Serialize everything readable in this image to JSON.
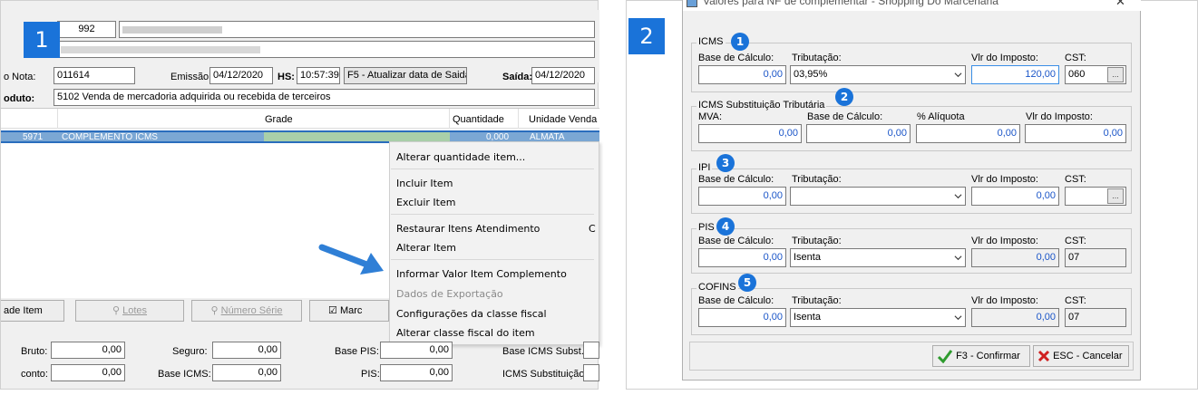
{
  "panel1": {
    "badge": "1",
    "header": {
      "code": "992"
    },
    "nota_label": "o Nota:",
    "nota_value": "011614",
    "emissao_label": "Emissão:",
    "emissao_value": "04/12/2020",
    "hs_label": "HS:",
    "hs_value": "10:57:39",
    "f5_label": "F5 - Atualizar data de Saida",
    "saida_label": "Saída:",
    "saida_value": "04/12/2020",
    "produto_label": "oduto:",
    "produto_value": "5102 Venda de mercadoria adquirida ou recebida de terceiros",
    "columns": {
      "grade": "Grade",
      "quantidade": "Quantidade",
      "unidade": "Unidade Venda"
    },
    "row": {
      "code": "5971",
      "desc": "COMPLEMENTO ICMS",
      "qty": "0,000",
      "unit": "ALMATA"
    },
    "context_menu": {
      "alterar_qtd": "Alterar quantidade item...",
      "incluir": "Incluir Item",
      "excluir": "Excluir Item",
      "restaurar": "Restaurar Itens Atendimento",
      "restaurar_shortcut": "C",
      "alterar_item": "Alterar Item",
      "informar": "Informar Valor Item Complemento",
      "dados_exportacao": "Dados de Exportação",
      "configuracoes": "Configurações da classe fiscal",
      "alterar_classe": "Alterar classe fiscal do item"
    },
    "buttons": {
      "item": "ade Item",
      "lotes": "Lotes",
      "numero_serie": "Número Série",
      "marcar": "Marc"
    },
    "totals": {
      "bruto_label": "Bruto:",
      "bruto": "0,00",
      "seguro_label": "Seguro:",
      "seguro": "0,00",
      "base_pis_label": "Base PIS:",
      "base_pis": "0,00",
      "base_icms_subst_label": "Base ICMS Subst.:",
      "desconto_label": "conto:",
      "desconto": "0,00",
      "base_icms_label": "Base ICMS:",
      "base_icms": "0,00",
      "pis_label": "PIS:",
      "pis": "0,00",
      "icms_subst_label": "ICMS Substituição:"
    }
  },
  "panel2": {
    "badge": "2",
    "title": "Valores para NF de complementar - Shopping Do Marcenaria",
    "icms": {
      "title": "ICMS",
      "badge": "1",
      "base_label": "Base de Cálculo:",
      "base": "0,00",
      "trib_label": "Tributação:",
      "trib": "03,95%",
      "vlr_label": "Vlr do Imposto:",
      "vlr": "120,00",
      "cst_label": "CST:",
      "cst": "060"
    },
    "icms_st": {
      "title": "ICMS Substituição Tributária",
      "badge": "2",
      "mva_label": "MVA:",
      "mva": "0,00",
      "base_label": "Base de Cálculo:",
      "base": "0,00",
      "aliq_label": "% Alíquota",
      "aliq": "0,00",
      "vlr_label": "Vlr do Imposto:",
      "vlr": "0,00"
    },
    "ipi": {
      "title": "IPI",
      "badge": "3",
      "base_label": "Base de Cálculo:",
      "base": "0,00",
      "trib_label": "Tributação:",
      "trib": "",
      "vlr_label": "Vlr do Imposto:",
      "vlr": "0,00",
      "cst_label": "CST:",
      "cst": ""
    },
    "pis": {
      "title": "PIS",
      "badge": "4",
      "base_label": "Base de Cálculo:",
      "base": "0,00",
      "trib_label": "Tributação:",
      "trib": "Isenta",
      "vlr_label": "Vlr do Imposto:",
      "vlr": "0,00",
      "cst_label": "CST:",
      "cst": "07"
    },
    "cofins": {
      "title": "COFINS",
      "badge": "5",
      "base_label": "Base de Cálculo:",
      "base": "0,00",
      "trib_label": "Tributação:",
      "trib": "Isenta",
      "vlr_label": "Vlr do Imposto:",
      "vlr": "0,00",
      "cst_label": "CST:",
      "cst": "07"
    },
    "confirm": "F3 - Confirmar",
    "cancel": "ESC - Cancelar"
  }
}
